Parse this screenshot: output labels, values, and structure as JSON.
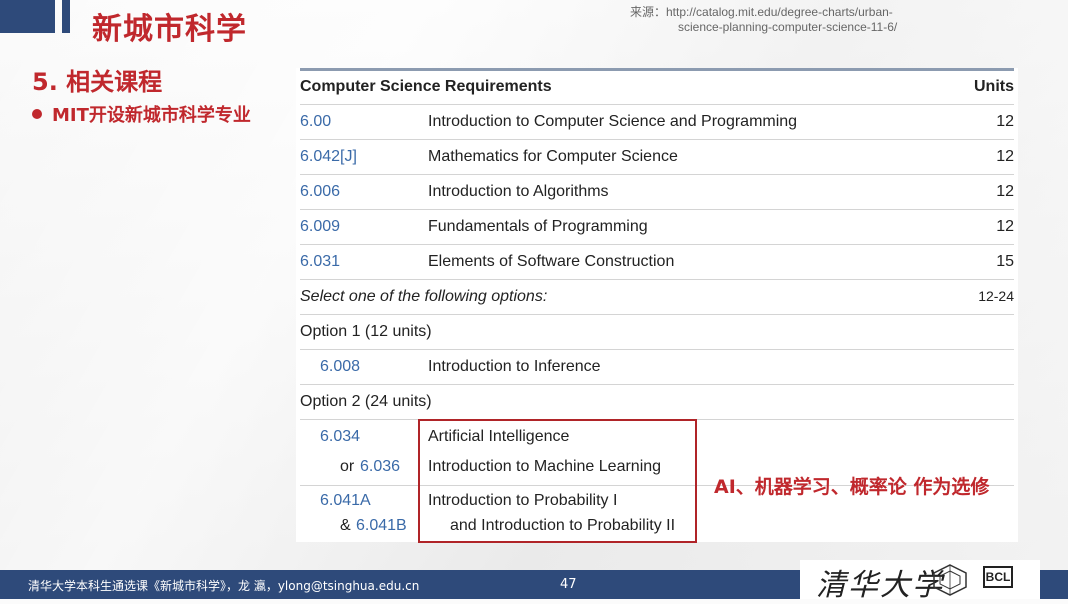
{
  "header": {
    "title": "新城市科学",
    "source_line1": "来源：http://catalog.mit.edu/degree-charts/urban-",
    "source_line2": "science-planning-computer-science-11-6/"
  },
  "section_title": "5. 相关课程",
  "bullet": "MIT开设新城市科学专业",
  "table": {
    "header_title": "Computer Science Requirements",
    "header_units": "Units",
    "rows": [
      {
        "code": "6.00",
        "desc": "Introduction to Computer Science and Programming",
        "units": "12"
      },
      {
        "code": "6.042[J]",
        "desc": "Mathematics for Computer Science",
        "units": "12"
      },
      {
        "code": "6.006",
        "desc": "Introduction to Algorithms",
        "units": "12"
      },
      {
        "code": "6.009",
        "desc": "Fundamentals of Programming",
        "units": "12"
      },
      {
        "code": "6.031",
        "desc": "Elements of Software Construction",
        "units": "15"
      }
    ],
    "select_text": "Select one of the following options:",
    "select_units": "12-24",
    "option1_label": "Option 1 (12 units)",
    "option1_code": "6.008",
    "option1_desc": "Introduction to Inference",
    "option2_label": "Option 2 (24 units)",
    "option2_code_a": "6.034",
    "option2_desc_a": "Artificial Intelligence",
    "option2_or": "or",
    "option2_code_b": "6.036",
    "option2_desc_b": "Introduction to Machine Learning",
    "option2_code_c": "6.041A",
    "option2_desc_c": "Introduction to Probability I",
    "option2_amp": "&",
    "option2_code_d": "6.041B",
    "option2_desc_d": "and Introduction to Probability II"
  },
  "annotation": "AI、机器学习、概率论 作为选修",
  "footer": {
    "text": "清华大学本科生通选课《新城市科学》，龙 瀛，ylong@tsinghua.edu.cn",
    "page": "47",
    "logo_text": "清华大学",
    "lab_logo": "BCL"
  },
  "colors": {
    "accent_red": "#c0282d",
    "navy": "#2e4a7a",
    "link_blue": "#3a6aa8"
  }
}
